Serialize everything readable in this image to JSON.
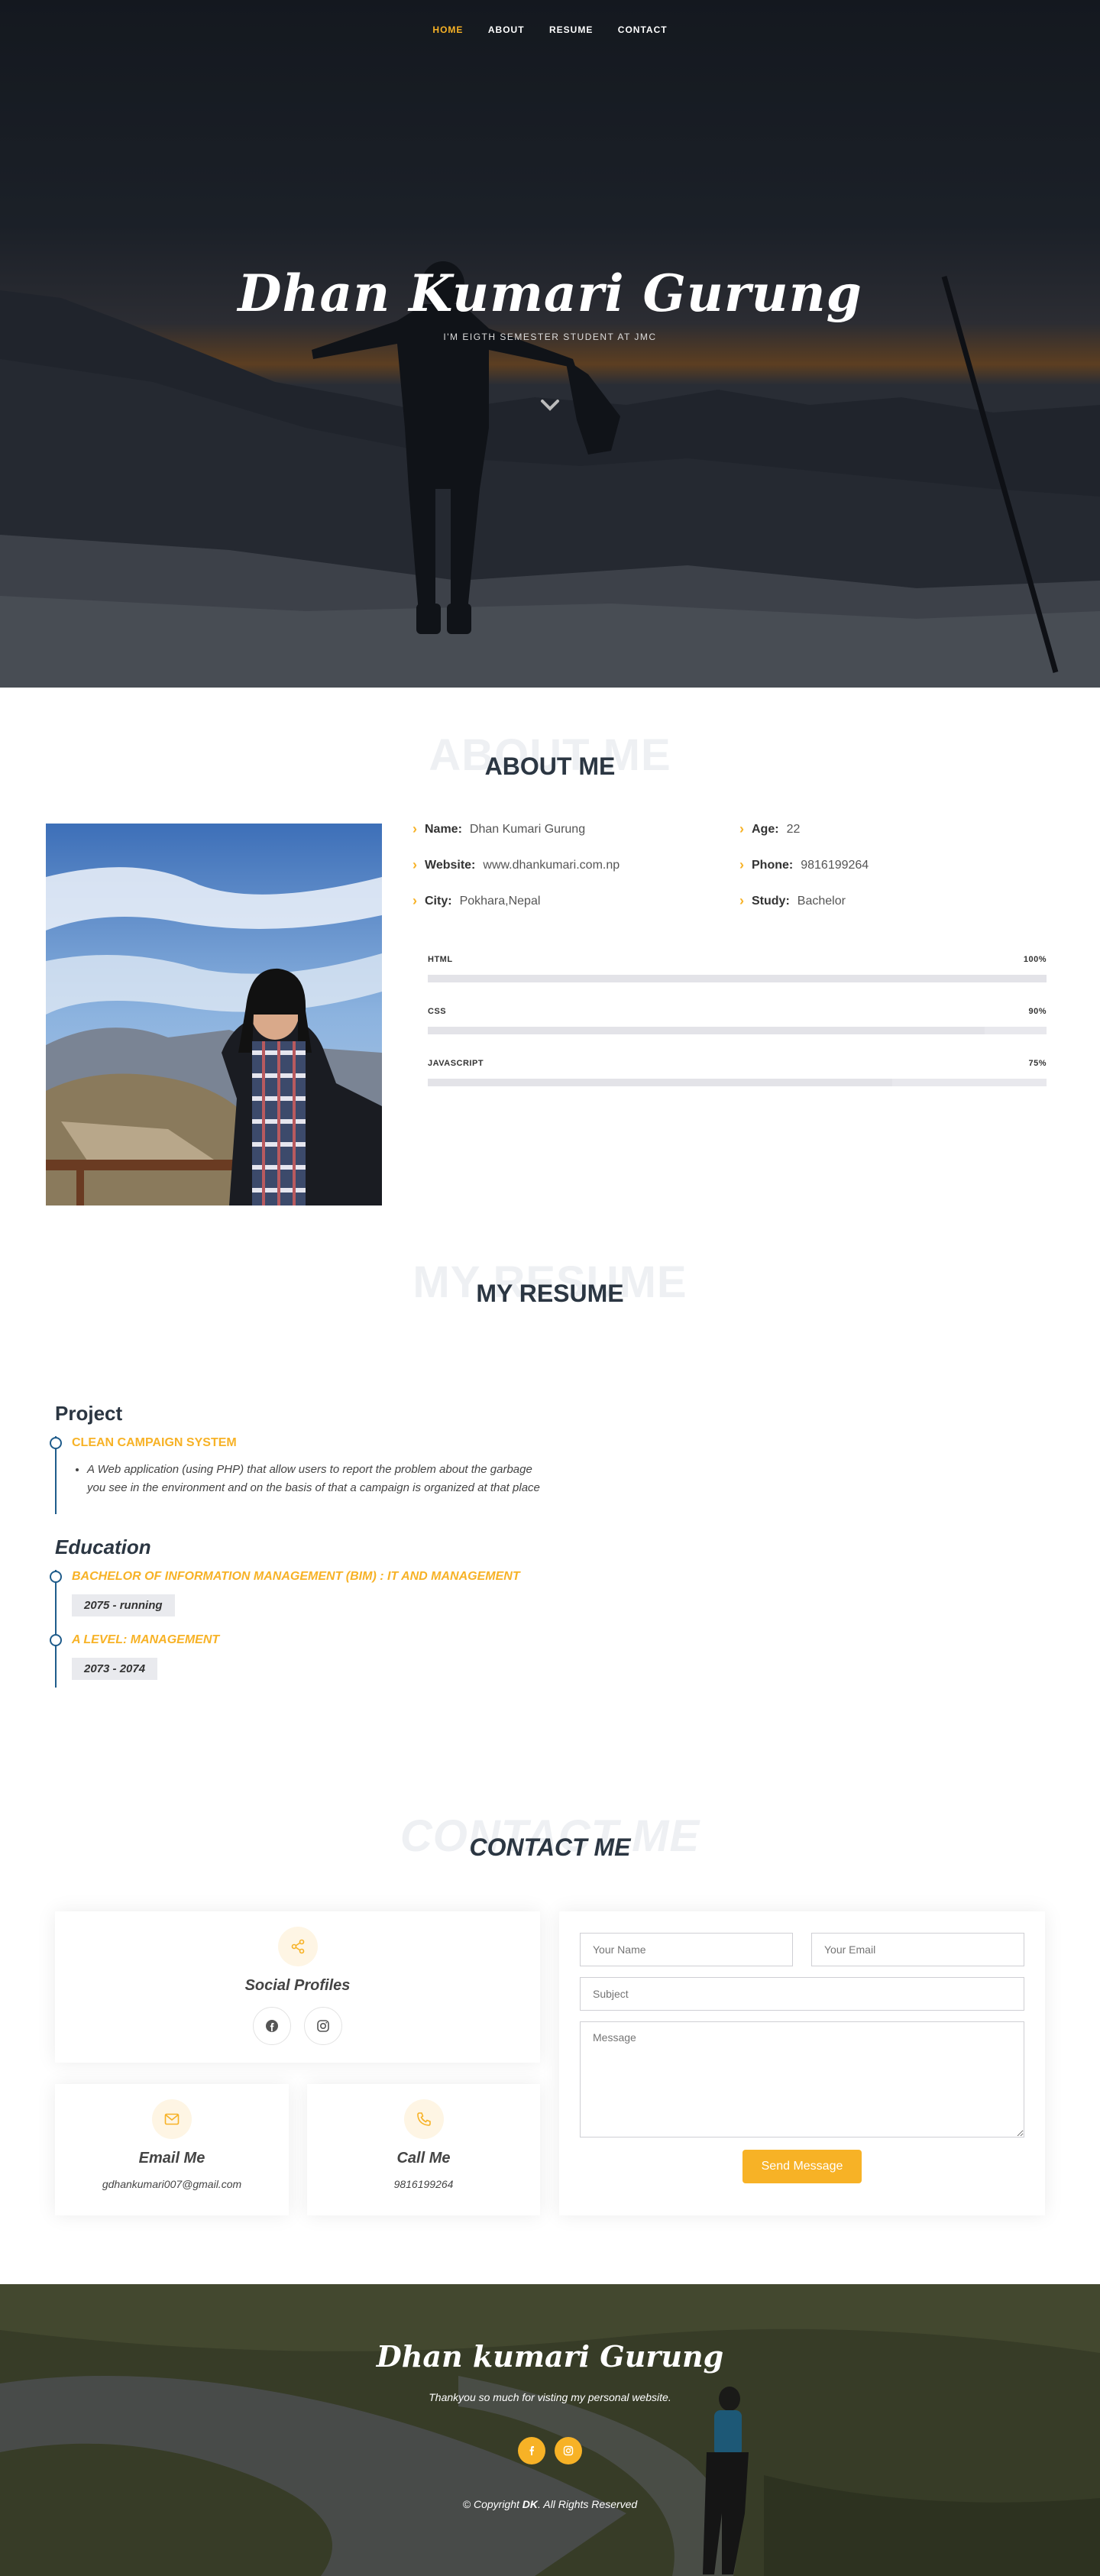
{
  "nav": {
    "items": [
      {
        "label": "HOME"
      },
      {
        "label": "ABOUT"
      },
      {
        "label": "RESUME"
      },
      {
        "label": "CONTACT"
      }
    ]
  },
  "hero": {
    "name": "Dhan Kumari Gurung",
    "subtitle": "I'M EIGTH SEMESTER STUDENT AT JMC"
  },
  "about": {
    "bg_title": "ABOUT ME",
    "title": "ABOUT ME",
    "info": [
      {
        "label": "Name:",
        "value": "Dhan Kumari Gurung"
      },
      {
        "label": "Age:",
        "value": "22"
      },
      {
        "label": "Website:",
        "value": "www.dhankumari.com.np"
      },
      {
        "label": "Phone:",
        "value": "9816199264"
      },
      {
        "label": "City:",
        "value": "Pokhara,Nepal"
      },
      {
        "label": "Study:",
        "value": "Bachelor"
      }
    ],
    "skills": [
      {
        "name": "HTML",
        "percent_label": "100%",
        "level": 1.0
      },
      {
        "name": "CSS",
        "percent_label": "90%",
        "level": 0.9
      },
      {
        "name": "JAVASCRIPT",
        "percent_label": "75%",
        "level": 0.75
      }
    ]
  },
  "resume": {
    "bg_title": "MY RESUME",
    "title": "MY RESUME",
    "project_heading": "Project",
    "project_title": "CLEAN CAMPAIGN SYSTEM",
    "project_desc": "A Web application (using PHP) that allow users to report the problem about the garbage you see in the environment and on the basis of that a campaign is organized at that place",
    "education_heading": "Education",
    "education": [
      {
        "title": "BACHELOR OF INFORMATION MANAGEMENT (BIM) : IT AND MANAGEMENT",
        "date": "2075 - running"
      },
      {
        "title": "A LEVEL: MANAGEMENT",
        "date": "2073 - 2074"
      }
    ]
  },
  "contact": {
    "bg_title": "CONTACT ME",
    "title": "CONTACT ME",
    "social_heading": "Social Profiles",
    "email_heading": "Email Me",
    "email_value": "gdhankumari007@gmail.com",
    "call_heading": "Call Me",
    "call_value": "9816199264",
    "form": {
      "name_placeholder": "Your Name",
      "email_placeholder": "Your Email",
      "subject_placeholder": "Subject",
      "message_placeholder": "Message",
      "send_label": "Send Message"
    }
  },
  "footer": {
    "title": "Dhan kumari Gurung",
    "subtitle": "Thankyou so much for visting my personal website.",
    "copy_prefix": "© Copyright ",
    "copy_brand": "DK",
    "copy_suffix": ". All Rights Reserved"
  },
  "colors": {
    "accent": "#f7b226",
    "heading": "#2b3642",
    "timeline": "#1f5c8b"
  }
}
